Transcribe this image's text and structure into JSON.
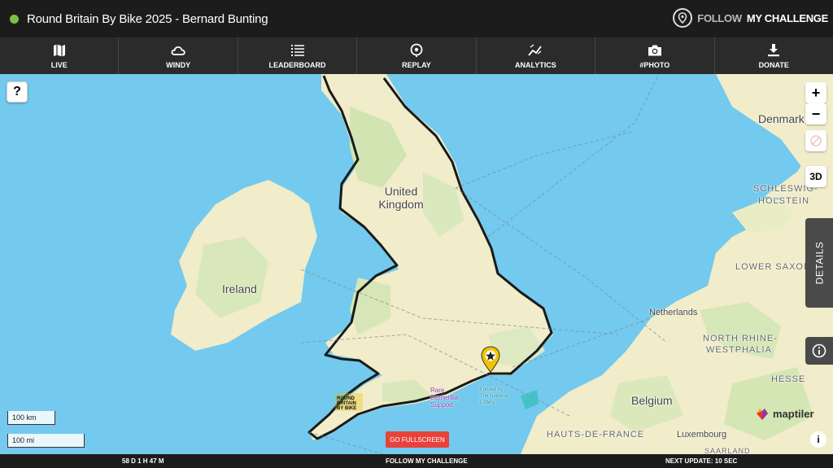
{
  "header": {
    "status_color": "#7bc144",
    "title": "Round Britain By Bike 2025 - Bernard Bunting",
    "brand_light": "FOLLOW",
    "brand_bold": "MY CHALLENGE"
  },
  "nav": {
    "items": [
      {
        "label": "LIVE",
        "icon": "map-icon"
      },
      {
        "label": "WINDY",
        "icon": "cloud-icon"
      },
      {
        "label": "LEADERBOARD",
        "icon": "list-icon"
      },
      {
        "label": "REPLAY",
        "icon": "location-icon"
      },
      {
        "label": "ANALYTICS",
        "icon": "chart-icon"
      },
      {
        "label": "#PHOTO",
        "icon": "camera-icon"
      },
      {
        "label": "DONATE",
        "icon": "download-icon"
      }
    ]
  },
  "map": {
    "help_label": "?",
    "zoom_in": "+",
    "zoom_out": "−",
    "threed": "3D",
    "details": "DETAILS",
    "scale_km": "100 km",
    "scale_mi": "100 mi",
    "fullscreen": "GO FULLSCREEN",
    "attribution": "i",
    "maptiler": "maptiler",
    "labels": {
      "denmark": "Denmark",
      "uk": "United Kingdom",
      "ireland": "Ireland",
      "netherlands": "Netherlands",
      "belgium": "Belgium",
      "luxembourg": "Luxembourg",
      "schleswig": "SCHLESWIG-",
      "holstein": "HOLSTEIN",
      "lower_saxony": "LOWER SAXON",
      "nrw1": "NORTH RHINE-",
      "nrw2": "WESTPHALIA",
      "hesse": "HESSE",
      "hauts": "HAUTS-DE-FRANCE",
      "saarland": "SAARLAND",
      "rare1": "Rare",
      "rare2": "Dementia",
      "rare3": "Support",
      "funded": "Funded by",
      "national1": "The National",
      "national2": "Lottery"
    },
    "route_color": "#1a1a1a",
    "marker_color": "#f2c400"
  },
  "footer": {
    "elapsed": "58 D 1 H 47 M",
    "center": "FOLLOW MY CHALLENGE",
    "next_update": "NEXT UPDATE: 10 SEC"
  }
}
